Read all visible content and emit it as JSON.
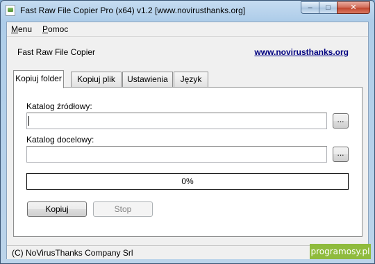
{
  "window": {
    "title": "Fast Raw File Copier Pro (x64) v1.2 [www.novirusthanks.org]",
    "icon": "app-file-icon",
    "controls": {
      "minimize": "–",
      "maximize": "□",
      "close": "✕"
    }
  },
  "menubar": {
    "items": [
      {
        "label_ul": "M",
        "label_rest": "enu"
      },
      {
        "label_ul": "P",
        "label_rest": "omoc"
      }
    ]
  },
  "header": {
    "title": "Fast Raw File Copier",
    "link": "www.novirusthanks.org"
  },
  "tabs": [
    {
      "label": "Kopiuj folder",
      "active": true
    },
    {
      "label": "Kopiuj plik",
      "active": false
    },
    {
      "label": "Ustawienia",
      "active": false
    },
    {
      "label": "Język",
      "active": false
    }
  ],
  "form": {
    "source_label": "Katalog źródłowy:",
    "source_value": "",
    "dest_label": "Katalog docelowy:",
    "dest_value": "",
    "browse_label": "...",
    "progress_value": 0,
    "progress_text": "0%"
  },
  "buttons": {
    "copy": "Kopiuj",
    "stop": "Stop"
  },
  "status": {
    "text": "(C) NoVirusThanks Company Srl"
  },
  "watermark": "programosy.pl",
  "colors": {
    "titlebar": "#aecde9",
    "link": "#000080",
    "progress_fill": "#3c9d3c",
    "watermark": "#8fbb3d"
  }
}
